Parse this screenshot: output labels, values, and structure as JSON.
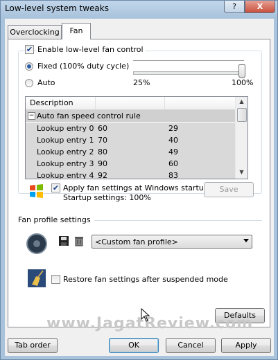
{
  "window": {
    "title": "Low-level system tweaks",
    "help_label": "?",
    "close_label": "X"
  },
  "tabs": [
    {
      "label": "Overclocking"
    },
    {
      "label": "Fan"
    }
  ],
  "fan_control": {
    "enable_label": "Enable low-level fan control",
    "enable_checked": true,
    "fixed_label": "Fixed (100% duty cycle)",
    "auto_label": "Auto",
    "slider_min_label": "25%",
    "slider_max_label": "100%",
    "slider_value_fraction": 1.0
  },
  "rule_list": {
    "headers": [
      "Description",
      "",
      ""
    ],
    "group_label": "Auto fan speed control rule",
    "rows": [
      {
        "name": "Lookup entry 0",
        "a": "60",
        "b": "29"
      },
      {
        "name": "Lookup entry 1",
        "a": "70",
        "b": "40"
      },
      {
        "name": "Lookup entry 2",
        "a": "80",
        "b": "49"
      },
      {
        "name": "Lookup entry 3",
        "a": "90",
        "b": "60"
      },
      {
        "name": "Lookup entry 4",
        "a": "92",
        "b": "83"
      }
    ]
  },
  "startup": {
    "apply_label": "Apply fan settings at Windows startup",
    "apply_checked": true,
    "settings_text": "Startup settings:  100%",
    "save_label": "Save"
  },
  "profiles": {
    "section_label": "Fan profile settings",
    "selected_profile": "<Custom fan profile>",
    "restore_label": "Restore fan settings after suspended mode",
    "restore_checked": false
  },
  "buttons": {
    "defaults": "Defaults",
    "tab_order": "Tab order",
    "ok": "OK",
    "cancel": "Cancel",
    "apply": "Apply"
  },
  "watermark": "www.JagatReview.com"
}
